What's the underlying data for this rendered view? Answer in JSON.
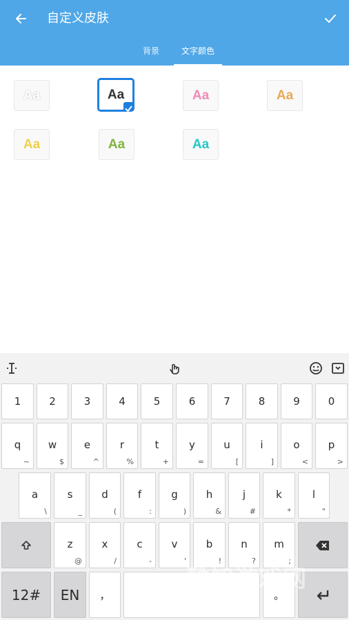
{
  "header": {
    "title": "自定义皮肤",
    "back_icon": "arrow-left-icon",
    "confirm_icon": "check-icon"
  },
  "tabs": [
    {
      "label": "背景",
      "active": false
    },
    {
      "label": "文字颜色",
      "active": true
    }
  ],
  "swatches": [
    {
      "label": "Aa",
      "color": "#ffffff",
      "selected": false
    },
    {
      "label": "Aa",
      "color": "#333333",
      "selected": true
    },
    {
      "label": "Aa",
      "color": "#f08bb4",
      "selected": false
    },
    {
      "label": "Aa",
      "color": "#e8a857",
      "selected": false
    },
    {
      "label": "Aa",
      "color": "#ecd24a",
      "selected": false
    },
    {
      "label": "Aa",
      "color": "#7fb43b",
      "selected": false
    },
    {
      "label": "Aa",
      "color": "#23c8c8",
      "selected": false
    }
  ],
  "keyboard": {
    "toolbar": [
      "cursor-icon",
      "handwriting-icon",
      "emoji-icon",
      "keyboard-hide-icon"
    ],
    "number_row": [
      "1",
      "2",
      "3",
      "4",
      "5",
      "6",
      "7",
      "8",
      "9",
      "0"
    ],
    "row1": [
      {
        "main": "q",
        "sub": "~"
      },
      {
        "main": "w",
        "sub": "$"
      },
      {
        "main": "e",
        "sub": "^"
      },
      {
        "main": "r",
        "sub": "%"
      },
      {
        "main": "t",
        "sub": "+"
      },
      {
        "main": "y",
        "sub": "="
      },
      {
        "main": "u",
        "sub": "["
      },
      {
        "main": "i",
        "sub": "]"
      },
      {
        "main": "o",
        "sub": "<"
      },
      {
        "main": "p",
        "sub": ">"
      }
    ],
    "row2": [
      {
        "main": "a",
        "sub": "\\"
      },
      {
        "main": "s",
        "sub": "_"
      },
      {
        "main": "d",
        "sub": "("
      },
      {
        "main": "f",
        "sub": ":"
      },
      {
        "main": "g",
        "sub": ")"
      },
      {
        "main": "h",
        "sub": "&"
      },
      {
        "main": "j",
        "sub": "#"
      },
      {
        "main": "k",
        "sub": "*"
      },
      {
        "main": "l",
        "sub": "\""
      }
    ],
    "row3": [
      {
        "main": "z",
        "sub": "@"
      },
      {
        "main": "x",
        "sub": "/"
      },
      {
        "main": "c",
        "sub": "-"
      },
      {
        "main": "v",
        "sub": "'"
      },
      {
        "main": "b",
        "sub": "!"
      },
      {
        "main": "n",
        "sub": "?"
      },
      {
        "main": "m",
        "sub": ";"
      }
    ],
    "bottom": {
      "sym": "12#",
      "lang": "EN",
      "comma": "，",
      "period": "。"
    }
  },
  "watermark": "酷知游戏网"
}
